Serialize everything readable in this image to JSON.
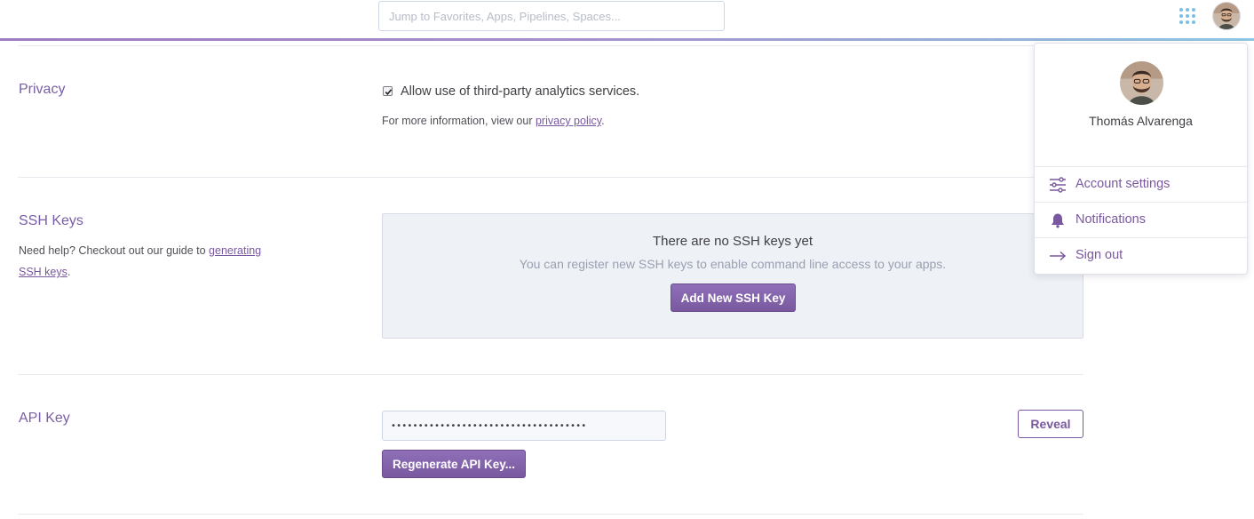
{
  "header": {
    "search_placeholder": "Jump to Favorites, Apps, Pipelines, Spaces...",
    "apps_icon": "grid-dots-icon",
    "accent_gradient": [
      "#9e7cc1",
      "#8fc7e3"
    ]
  },
  "privacy": {
    "title": "Privacy",
    "checkbox_label": "Allow use of third-party analytics services.",
    "checked": true,
    "info_prefix": "For more information, view our ",
    "info_link": "privacy policy",
    "info_suffix": "."
  },
  "ssh": {
    "title": "SSH Keys",
    "help_prefix": "Need help? Checkout out our guide to ",
    "help_link": "generating SSH keys",
    "help_suffix": ".",
    "empty_title": "There are no SSH keys yet",
    "empty_subtitle": "You can register new SSH keys to enable command line access to your apps.",
    "add_button": "Add New SSH Key"
  },
  "api": {
    "title": "API Key",
    "masked_value": "••••••••••••••••••••••••••••••••••••",
    "reveal_button": "Reveal",
    "regenerate_button": "Regenerate API Key..."
  },
  "account_menu": {
    "user_name": "Thomás Alvarenga",
    "items": [
      {
        "label": "Account settings",
        "icon": "sliders-icon"
      },
      {
        "label": "Notifications",
        "icon": "bell-icon"
      },
      {
        "label": "Sign out",
        "icon": "arrow-right-icon"
      }
    ]
  },
  "colors": {
    "brand": "#79589f",
    "section_title": "#7a5ea6",
    "empty_box_bg": "#eef1f6"
  }
}
